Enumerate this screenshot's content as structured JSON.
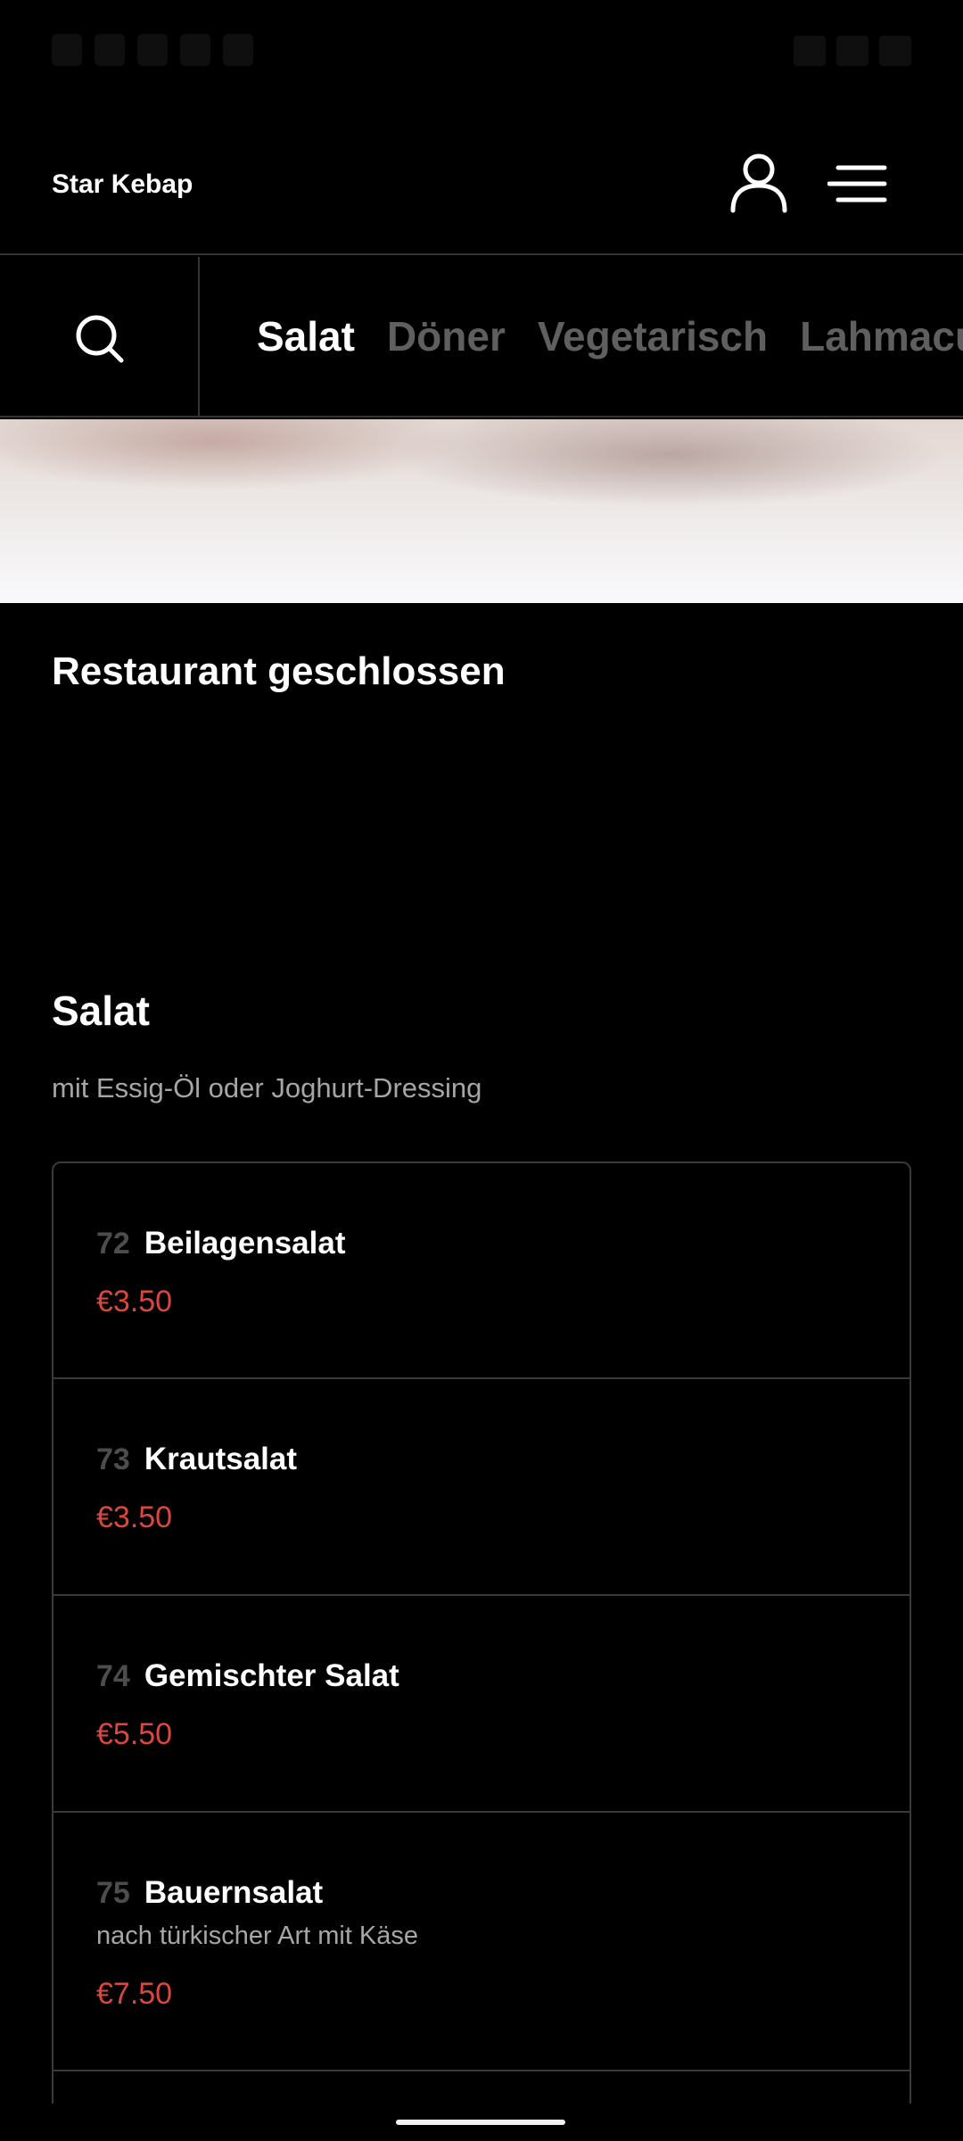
{
  "header": {
    "brand": "Star Kebap",
    "user_icon": "user-icon",
    "menu_icon": "hamburger-menu-icon"
  },
  "category_bar": {
    "search_icon": "search-icon",
    "categories": [
      "Salat",
      "Döner",
      "Vegetarisch",
      "Lahmacun"
    ],
    "active_index": 0
  },
  "status_message": "Restaurant geschlossen",
  "section": {
    "title": "Salat",
    "subtitle": "mit Essig-Öl oder Joghurt-Dressing",
    "items": [
      {
        "number": "72",
        "name": "Beilagensalat",
        "description": "",
        "price": "€3.50"
      },
      {
        "number": "73",
        "name": "Krautsalat",
        "description": "",
        "price": "€3.50"
      },
      {
        "number": "74",
        "name": "Gemischter Salat",
        "description": "",
        "price": "€5.50"
      },
      {
        "number": "75",
        "name": "Bauernsalat",
        "description": "nach türkischer Art mit Käse",
        "price": "€7.50"
      }
    ]
  },
  "colors": {
    "background": "#000000",
    "price": "#d9473e",
    "inactive_category": "#5f5f5f",
    "divider": "#3a3a3a"
  }
}
